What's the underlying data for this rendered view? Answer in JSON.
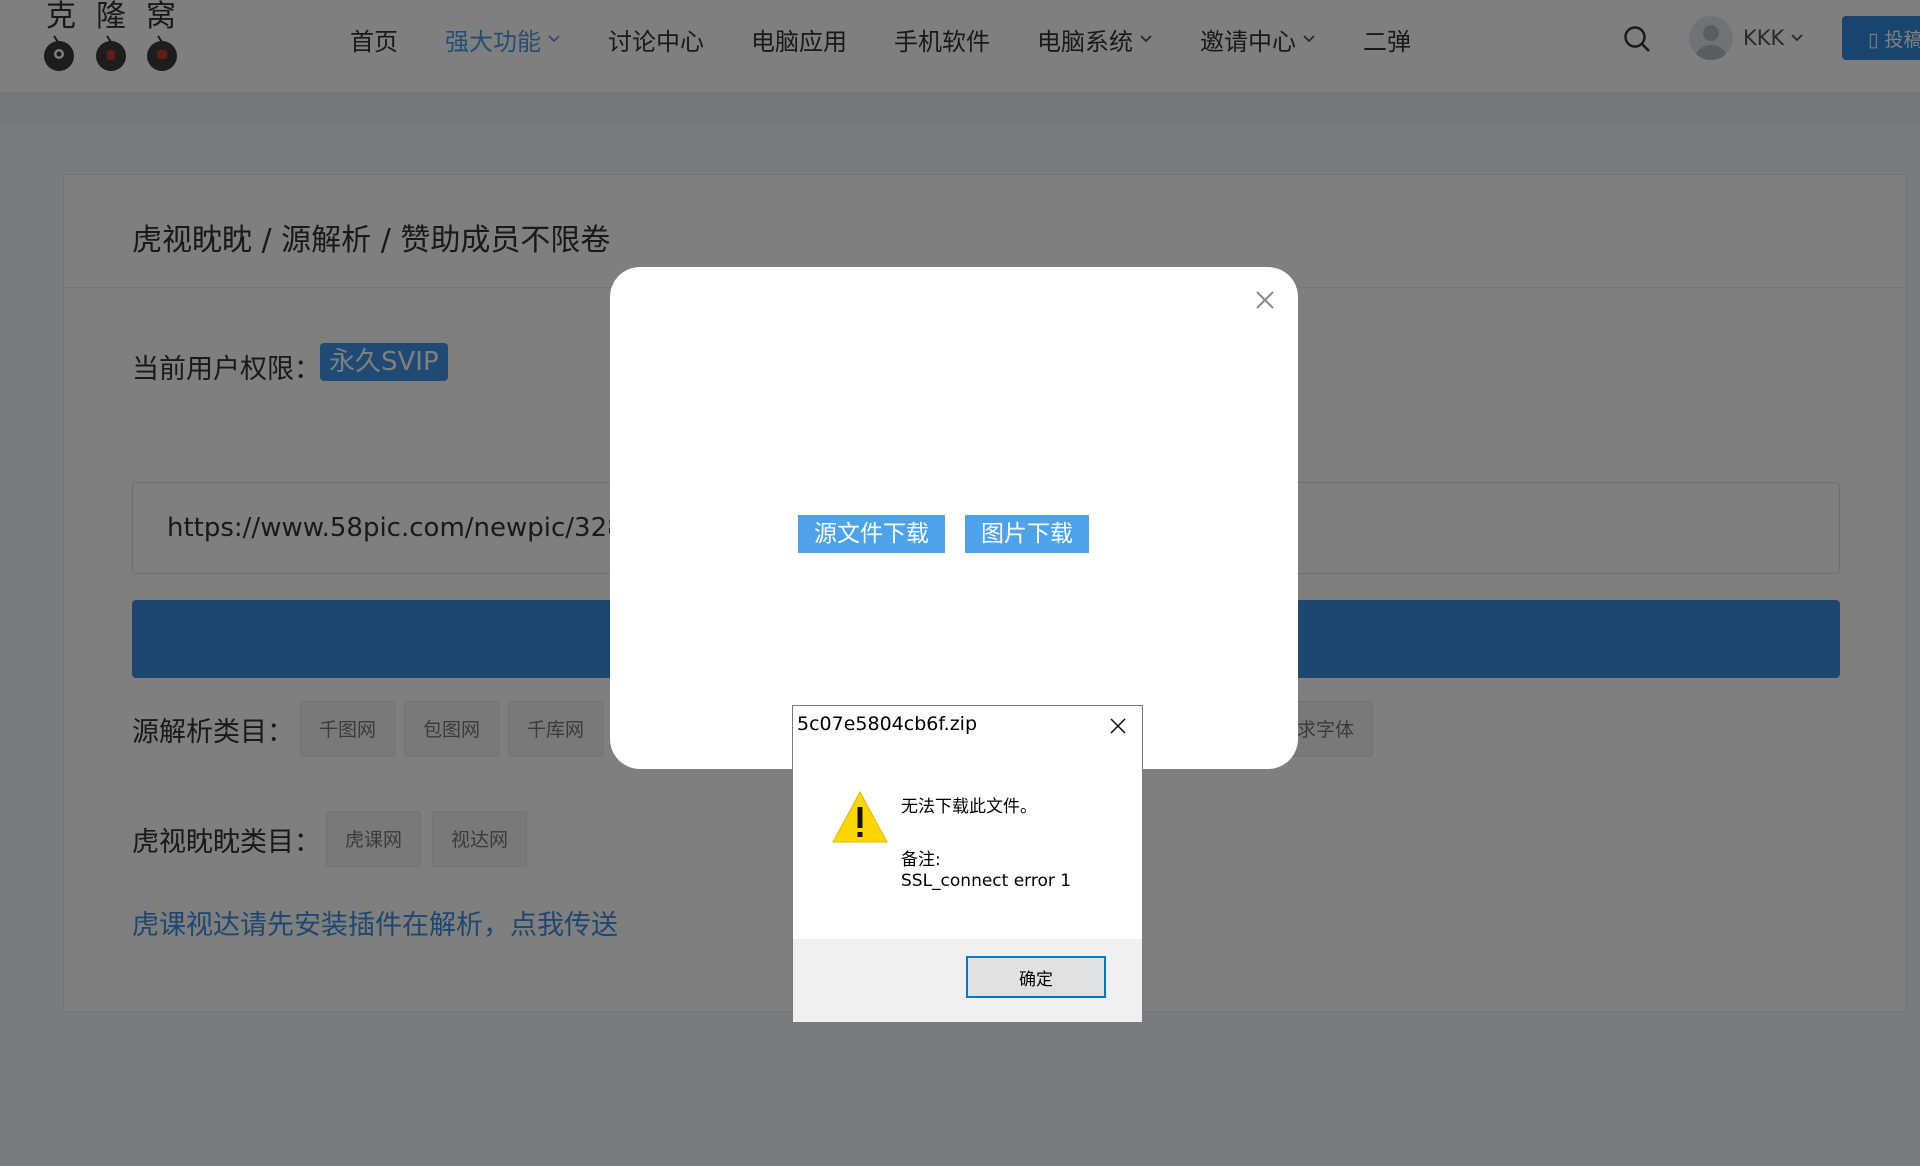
{
  "header": {
    "logo_text": "克隆窝",
    "nav": [
      {
        "label": "首页",
        "active": false,
        "dropdown": false
      },
      {
        "label": "强大功能",
        "active": true,
        "dropdown": true
      },
      {
        "label": "讨论中心",
        "active": false,
        "dropdown": false
      },
      {
        "label": "电脑应用",
        "active": false,
        "dropdown": false
      },
      {
        "label": "手机软件",
        "active": false,
        "dropdown": false
      },
      {
        "label": "电脑系统",
        "active": false,
        "dropdown": true
      },
      {
        "label": "邀请中心",
        "active": false,
        "dropdown": true
      },
      {
        "label": "二弹",
        "active": false,
        "dropdown": false
      }
    ],
    "user_name": "KKK",
    "submit_label": "▯ 投稿"
  },
  "main": {
    "title": "虎视眈眈 / 源解析 / 赞助成员不限卷",
    "permission_label": "当前用户权限：",
    "permission_badge": "永久SVIP",
    "url_value": "https://www.58pic.com/newpic/32809",
    "source_category_label": "源解析类目：",
    "source_tags": [
      "千图网",
      "包图网",
      "千库网"
    ],
    "source_tag_last": "求字体",
    "hushi_category_label": "虎视眈眈类目：",
    "hushi_tags": [
      "虎课网",
      "视达网"
    ],
    "plugin_link": "虎课视达请先安装插件在解析，点我传送"
  },
  "modal": {
    "source_download": "源文件下载",
    "image_download": "图片下载"
  },
  "win_dialog": {
    "title": "5c07e5804cb6f.zip",
    "message": "无法下载此文件。",
    "note_label": "备注:",
    "note": "SSL_connect error 1",
    "ok_label": "确定"
  },
  "colors": {
    "accent": "#3d8fe0",
    "warning": "#ffd700"
  }
}
